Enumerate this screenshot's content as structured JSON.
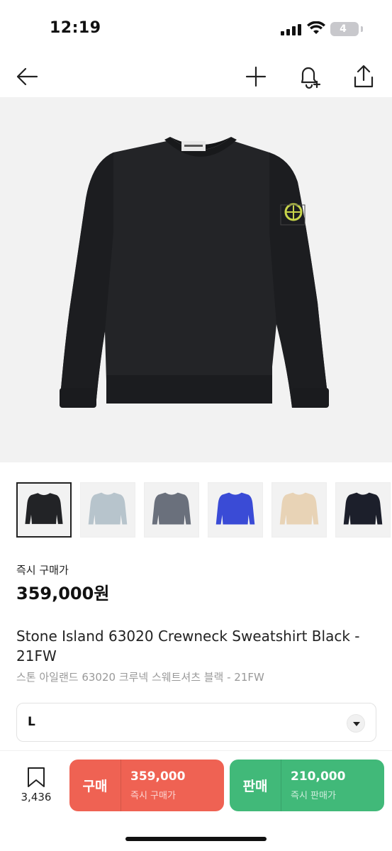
{
  "status_bar": {
    "time": "12:19",
    "battery": "4"
  },
  "nav": {
    "icons": [
      "back-arrow-icon",
      "plus-icon",
      "bell-plus-icon",
      "share-icon"
    ]
  },
  "product": {
    "thumbnails": [
      {
        "name": "Black",
        "color": "#222326",
        "active": true
      },
      {
        "name": "Light Blue",
        "color": "#b7c4cc",
        "active": false
      },
      {
        "name": "Grey Blue",
        "color": "#6a707c",
        "active": false
      },
      {
        "name": "Royal Blue",
        "color": "#3a4bd6",
        "active": false
      },
      {
        "name": "Beige",
        "color": "#e8d3b6",
        "active": false
      },
      {
        "name": "Navy",
        "color": "#1c1f2b",
        "active": false
      }
    ],
    "price_label": "즉시 구매가",
    "price": "359,000원",
    "title_en": "Stone Island 63020 Crewneck Sweatshirt Black - 21FW",
    "title_ko": "스톤 아일랜드 63020 크루넥 스웨트셔츠 블랙 - 21FW"
  },
  "size_select": {
    "value": "L"
  },
  "bottom_bar": {
    "wish_count": "3,436",
    "buy": {
      "label": "구매",
      "price": "359,000",
      "sub": "즉시 구매가",
      "color": "#ef6253"
    },
    "sell": {
      "label": "판매",
      "price": "210,000",
      "sub": "즉시 판매가",
      "color": "#41b979"
    }
  }
}
